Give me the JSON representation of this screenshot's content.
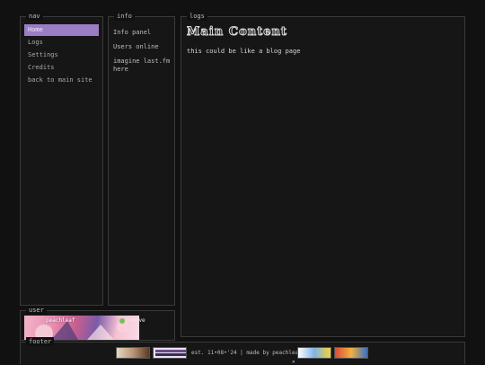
{
  "nav": {
    "title": "nav",
    "items": [
      {
        "label": "Home"
      },
      {
        "label": "Logs"
      },
      {
        "label": "Settings"
      },
      {
        "label": "Credits"
      },
      {
        "label": "back to main site"
      }
    ]
  },
  "info": {
    "title": "info",
    "items": [
      {
        "label": "Info panel"
      },
      {
        "label": "Users online"
      },
      {
        "label": "imagine last.fm here"
      }
    ]
  },
  "logs": {
    "title": "logs",
    "heading": "Main Content",
    "text": "this could be like a blog page"
  },
  "user": {
    "title": "user",
    "name": "peachleaf",
    "status": "pmarve"
  },
  "footer": {
    "title": "footer",
    "text": "est. 11•08•'24 | made by peachleaf"
  },
  "colors": {
    "accent": "#9a7dc4",
    "background": "#111111",
    "panel": "#161616",
    "border": "#3a3a3a"
  }
}
